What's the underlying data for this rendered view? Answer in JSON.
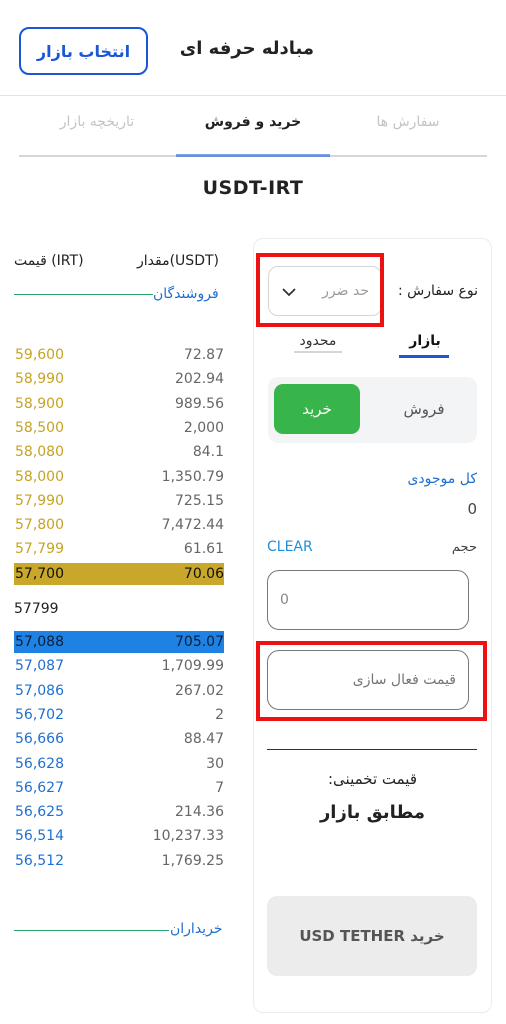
{
  "header": {
    "title": "مبادله حرفه ای",
    "market_button": "انتخاب بازار"
  },
  "tabs": [
    {
      "label": "سفارش ها",
      "active": false
    },
    {
      "label": "خرید و فروش",
      "active": true
    },
    {
      "label": "تاریخچه بازار",
      "active": false
    }
  ],
  "pair": "USDT-IRT",
  "orderbook": {
    "amount_header": "مقدار(USDT)",
    "price_header": "قیمت (IRT)",
    "sellers_label": "فروشندگان",
    "buyers_label": "خریداران",
    "asks": [
      {
        "price": "59,600",
        "amount": "72.87"
      },
      {
        "price": "58,990",
        "amount": "202.94"
      },
      {
        "price": "58,900",
        "amount": "989.56"
      },
      {
        "price": "58,500",
        "amount": "2,000"
      },
      {
        "price": "58,080",
        "amount": "84.1"
      },
      {
        "price": "58,000",
        "amount": "1,350.79"
      },
      {
        "price": "57,990",
        "amount": "725.15"
      },
      {
        "price": "57,800",
        "amount": "7,472.44"
      },
      {
        "price": "57,799",
        "amount": "61.61"
      },
      {
        "price": "57,700",
        "amount": "70.06"
      }
    ],
    "last_price": "57799",
    "bids": [
      {
        "price": "57,088",
        "amount": "705.07"
      },
      {
        "price": "57,087",
        "amount": "1,709.99"
      },
      {
        "price": "57,086",
        "amount": "267.02"
      },
      {
        "price": "56,702",
        "amount": "2"
      },
      {
        "price": "56,666",
        "amount": "88.47"
      },
      {
        "price": "56,628",
        "amount": "30"
      },
      {
        "price": "56,627",
        "amount": "7"
      },
      {
        "price": "56,625",
        "amount": "214.36"
      },
      {
        "price": "56,514",
        "amount": "10,237.33"
      },
      {
        "price": "56,512",
        "amount": "1,769.25"
      }
    ]
  },
  "order_form": {
    "order_type_label": "نوع سفارش :",
    "order_type_value": "حد ضرر",
    "type_tabs": {
      "market": "بازار",
      "limit": "محدود"
    },
    "sides": {
      "buy": "خرید",
      "sell": "فروش"
    },
    "balance_label": "کل موجودی",
    "balance_value": "0",
    "volume_label": "حجم",
    "clear_label": "CLEAR",
    "volume_value": "0",
    "trigger_price_placeholder": "قیمت فعال سازی",
    "estimate_label": "قیمت تخمینی:",
    "estimate_value": "مطابق بازار",
    "submit_label": "خرید USD TETHER"
  },
  "colors": {
    "accent": "#1a56d6",
    "buy": "#38b54a",
    "ask": "#c6a324",
    "bid": "#1f6fd1",
    "highlight": "#ee1111"
  }
}
